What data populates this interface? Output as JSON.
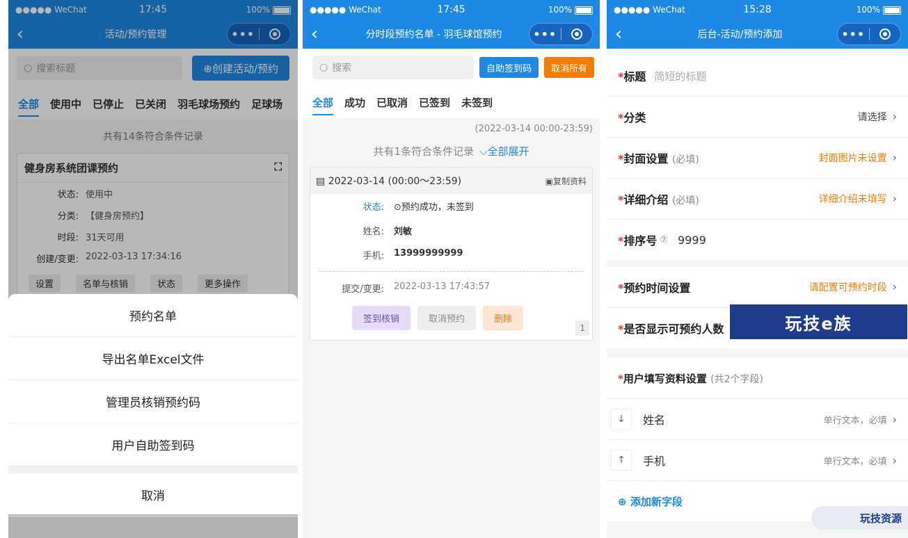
{
  "status": {
    "carrier": "●●●●● WeChat",
    "battery": "100%"
  },
  "phone1": {
    "time": "17:45",
    "title": "活动/预约管理",
    "search_placeholder": "搜索标题",
    "create_btn": "⊕创建活动/预约",
    "tabs": [
      "全部",
      "使用中",
      "已停止",
      "已关闭",
      "羽毛球场预约",
      "足球场"
    ],
    "count": "共有14条符合条件记录",
    "card": {
      "title": "健身房系统团课预约",
      "rows": [
        {
          "k": "状态:",
          "v": "使用中"
        },
        {
          "k": "分类:",
          "v": "【健身房预约】"
        },
        {
          "k": "时段:",
          "v": "31天可用"
        },
        {
          "k": "创建/变更:",
          "v": "2022-03-13 17:34:16"
        }
      ],
      "actions": [
        "设置",
        "名单与核销",
        "状态",
        "更多操作"
      ]
    },
    "sheet": [
      "预约名单",
      "导出名单Excel文件",
      "管理员核销预约码",
      "用户自助签到码"
    ],
    "cancel": "取消"
  },
  "phone2": {
    "time": "17:45",
    "title": "分时段预约名单 - 羽毛球馆预约",
    "search_placeholder": "搜索",
    "btn_checkin": "自助签到码",
    "btn_cancel_all": "取消所有",
    "tabs": [
      "全部",
      "成功",
      "已取消",
      "已签到",
      "未签到"
    ],
    "date_range": "(2022-03-14 00:00-23:59)",
    "count": "共有1条符合条件记录",
    "expand": "全部展开",
    "card": {
      "date": "2022-03-14 (00:00～23:59)",
      "copy": "复制资料",
      "status_k": "状态:",
      "status_v": "⊙预约成功，未签到",
      "name_k": "姓名:",
      "name_v": "刘敏",
      "phone_k": "手机:",
      "phone_v": "13999999999",
      "submit_k": "提交/变更:",
      "submit_v": "2022-03-13 17:43:57",
      "act_checkin": "签到核销",
      "act_cancel": "取消预约",
      "act_delete": "删除",
      "page": "1"
    }
  },
  "phone3": {
    "time": "15:28",
    "title": "后台-活动/预约添加",
    "fields": {
      "title_label": "标题",
      "title_ph": "简短的标题",
      "cat_label": "分类",
      "cat_value": "请选择",
      "cover_label": "封面设置",
      "cover_sub": "(必填)",
      "cover_value": "封面图片未设置",
      "detail_label": "详细介绍",
      "detail_sub": "(必填)",
      "detail_value": "详细介绍未填写",
      "sort_label": "排序号",
      "sort_value": "9999",
      "time_label": "预约时间设置",
      "time_value": "请配置可预约时段",
      "show_label": "是否显示可预约人数",
      "user_label": "用户填写资料设置",
      "user_sub": "(共2个字段)",
      "f1": "姓名",
      "f1_type": "单行文本，必填",
      "f2": "手机",
      "f2_type": "单行文本，必填",
      "add": "添加新字段"
    }
  },
  "banner": "玩技e族",
  "watermark": "玩技资源"
}
